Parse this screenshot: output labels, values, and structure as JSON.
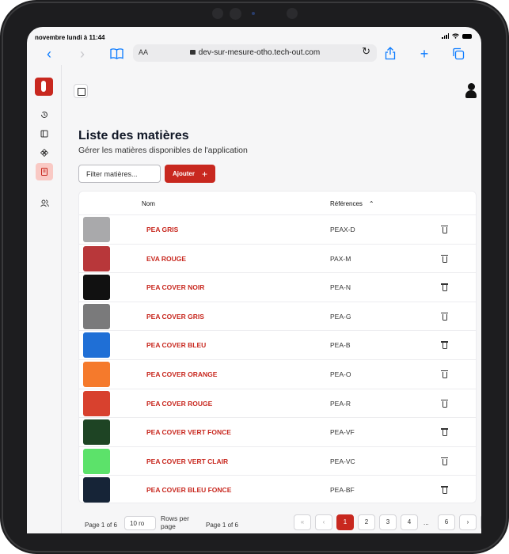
{
  "status": {
    "time": "novembre lundi à 11:44"
  },
  "browser": {
    "text_size_label": "AA",
    "url": "dev-sur-mesure-otho.tech-out.com"
  },
  "page": {
    "title": "Liste des matières",
    "subtitle": "Gérer les matières disponibles de l'application",
    "filter_placeholder": "Filter matières...",
    "add_label": "Ajouter",
    "add_icon": "plus-icon"
  },
  "table": {
    "col_name": "Nom",
    "col_ref": "Références",
    "rows": [
      {
        "name": "PEA GRIS",
        "ref": "PEAX-D",
        "color": "#a9a9ab"
      },
      {
        "name": "EVA ROUGE",
        "ref": "PAX-M",
        "color": "#b8373a"
      },
      {
        "name": "PEA COVER NOIR",
        "ref": "PEA-N",
        "color": "#111111"
      },
      {
        "name": "PEA COVER GRIS",
        "ref": "PEA-G",
        "color": "#7a7a7b"
      },
      {
        "name": "PEA COVER BLEU",
        "ref": "PEA-B",
        "color": "#1f6fd6"
      },
      {
        "name": "PEA COVER ORANGE",
        "ref": "PEA-O",
        "color": "#f57a2c"
      },
      {
        "name": "PEA COVER ROUGE",
        "ref": "PEA-R",
        "color": "#d8412e"
      },
      {
        "name": "PEA COVER VERT FONCE",
        "ref": "PEA-VF",
        "color": "#1e4424"
      },
      {
        "name": "PEA COVER VERT CLAIR",
        "ref": "PEA-VC",
        "color": "#5ce26a"
      },
      {
        "name": "PEA COVER BLEU FONCE",
        "ref": "PEA-BF",
        "color": "#162437"
      }
    ]
  },
  "pagination": {
    "info": "Page 1 of 6",
    "rows_value": "10 ro",
    "rows_label": "Rows per page",
    "info2": "Page 1 of 6",
    "pages": [
      "1",
      "2",
      "3",
      "4"
    ],
    "last_page": "6",
    "ellipsis": "..."
  },
  "colors": {
    "accent": "#c8281f"
  }
}
